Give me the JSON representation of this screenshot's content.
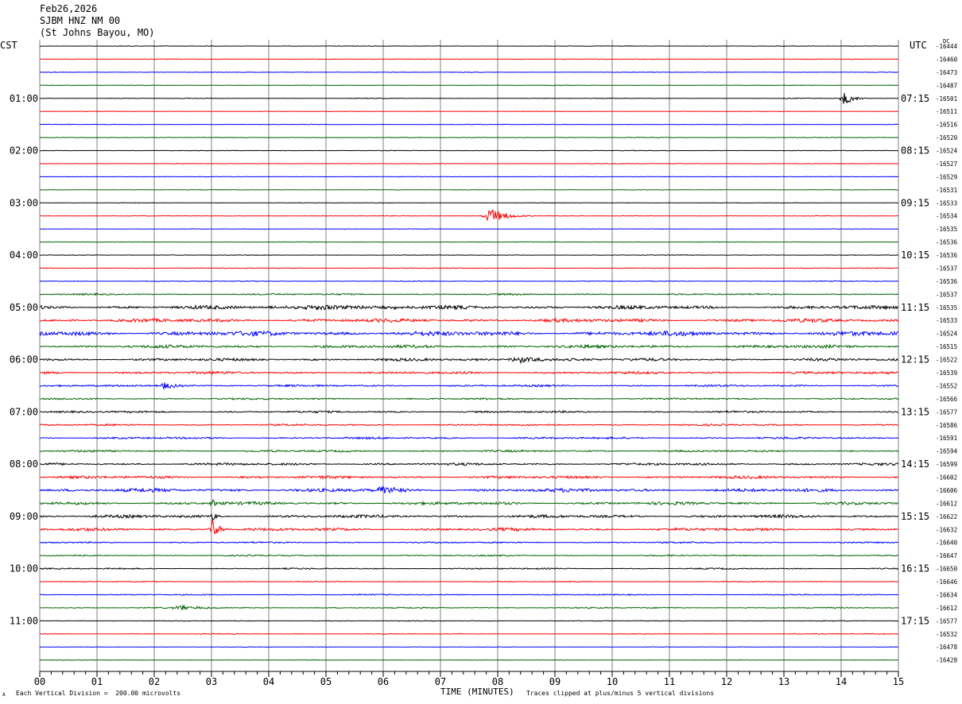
{
  "header": {
    "date": "Feb26,2026",
    "station": "SJBM HNZ NM 00",
    "location": "(St Johns Bayou, MO)"
  },
  "left_tz": "CST",
  "right_tz": "UTC",
  "dc_label": "DC",
  "footer": {
    "scale_note": "Each Vertical Division =  200.00 microvolts",
    "x_title": "TIME (MINUTES)",
    "clip_note": "Traces clipped at plus/minus 5 vertical divisions",
    "corner_mark": "A"
  },
  "colors": {
    "trace_cycle": [
      "#000000",
      "#ff0000",
      "#0000ff",
      "#006400"
    ],
    "grid": "#808080"
  },
  "chart_data": {
    "type": "line",
    "subtype": "helicorder",
    "x_label": "TIME (MINUTES)",
    "x_ticks": [
      "00",
      "01",
      "02",
      "03",
      "04",
      "05",
      "06",
      "07",
      "08",
      "09",
      "10",
      "11",
      "12",
      "13",
      "14",
      "15"
    ],
    "xlim": [
      0,
      15
    ],
    "minor_ticks_per_minute": 5,
    "grid": true,
    "rows": [
      {
        "left": "",
        "right": "",
        "dc": "-16444"
      },
      {
        "left": "",
        "right": "",
        "dc": "-16460"
      },
      {
        "left": "",
        "right": "",
        "dc": "-16473"
      },
      {
        "left": "",
        "right": "",
        "dc": "-16487"
      },
      {
        "left": "01:00",
        "right": "07:15",
        "dc": "-16501"
      },
      {
        "left": "",
        "right": "",
        "dc": "-16511"
      },
      {
        "left": "",
        "right": "",
        "dc": "-16516"
      },
      {
        "left": "",
        "right": "",
        "dc": "-16520"
      },
      {
        "left": "02:00",
        "right": "08:15",
        "dc": "-16524"
      },
      {
        "left": "",
        "right": "",
        "dc": "-16527"
      },
      {
        "left": "",
        "right": "",
        "dc": "-16529"
      },
      {
        "left": "",
        "right": "",
        "dc": "-16531"
      },
      {
        "left": "03:00",
        "right": "09:15",
        "dc": "-16533"
      },
      {
        "left": "",
        "right": "",
        "dc": "-16534"
      },
      {
        "left": "",
        "right": "",
        "dc": "-16535"
      },
      {
        "left": "",
        "right": "",
        "dc": "-16536"
      },
      {
        "left": "04:00",
        "right": "10:15",
        "dc": "-16536"
      },
      {
        "left": "",
        "right": "",
        "dc": "-16537"
      },
      {
        "left": "",
        "right": "",
        "dc": "-16536"
      },
      {
        "left": "",
        "right": "",
        "dc": "-16537"
      },
      {
        "left": "05:00",
        "right": "11:15",
        "dc": "-16535"
      },
      {
        "left": "",
        "right": "",
        "dc": "-16533"
      },
      {
        "left": "",
        "right": "",
        "dc": "-16524"
      },
      {
        "left": "",
        "right": "",
        "dc": "-16515"
      },
      {
        "left": "06:00",
        "right": "12:15",
        "dc": "-16522"
      },
      {
        "left": "",
        "right": "",
        "dc": "-16539"
      },
      {
        "left": "",
        "right": "",
        "dc": "-16552"
      },
      {
        "left": "",
        "right": "",
        "dc": "-16566"
      },
      {
        "left": "07:00",
        "right": "13:15",
        "dc": "-16577"
      },
      {
        "left": "",
        "right": "",
        "dc": "-16586"
      },
      {
        "left": "",
        "right": "",
        "dc": "-16591"
      },
      {
        "left": "",
        "right": "",
        "dc": "-16594"
      },
      {
        "left": "08:00",
        "right": "14:15",
        "dc": "-16599"
      },
      {
        "left": "",
        "right": "",
        "dc": "-16602"
      },
      {
        "left": "",
        "right": "",
        "dc": "-16606"
      },
      {
        "left": "",
        "right": "",
        "dc": "-16612"
      },
      {
        "left": "09:00",
        "right": "15:15",
        "dc": "-16622"
      },
      {
        "left": "",
        "right": "",
        "dc": "-16632"
      },
      {
        "left": "",
        "right": "",
        "dc": "-16640"
      },
      {
        "left": "",
        "right": "",
        "dc": "-16647"
      },
      {
        "left": "10:00",
        "right": "16:15",
        "dc": "-16650"
      },
      {
        "left": "",
        "right": "",
        "dc": "-16646"
      },
      {
        "left": "",
        "right": "",
        "dc": "-16634"
      },
      {
        "left": "",
        "right": "",
        "dc": "-16612"
      },
      {
        "left": "11:00",
        "right": "17:15",
        "dc": "-16577"
      },
      {
        "left": "",
        "right": "",
        "dc": "-16532"
      },
      {
        "left": "",
        "right": "",
        "dc": "-16478"
      },
      {
        "left": "",
        "right": "",
        "dc": "-16428"
      }
    ],
    "noise_level": [
      0.3,
      0.3,
      0.3,
      0.3,
      0.35,
      0.3,
      0.3,
      0.3,
      0.3,
      0.3,
      0.3,
      0.3,
      0.3,
      0.3,
      0.3,
      0.3,
      0.35,
      0.35,
      0.4,
      0.8,
      1.8,
      1.8,
      2.4,
      1.6,
      1.4,
      1.3,
      1.0,
      0.9,
      1.0,
      0.9,
      1.0,
      1.0,
      1.2,
      1.4,
      1.8,
      1.5,
      1.5,
      1.5,
      0.8,
      0.7,
      0.7,
      0.5,
      0.6,
      0.6,
      0.4,
      0.4,
      0.3,
      0.3
    ],
    "events": [
      {
        "row": 4,
        "minute": 14.05,
        "amplitude": 10,
        "duration": 0.15
      },
      {
        "row": 13,
        "minute": 7.9,
        "amplitude": 9,
        "duration": 0.3
      },
      {
        "row": 37,
        "minute": 3.02,
        "amplitude": 14,
        "duration": 0.12
      },
      {
        "row": 36,
        "minute": 3.02,
        "amplitude": 6,
        "duration": 0.1
      },
      {
        "row": 35,
        "minute": 3.02,
        "amplitude": 5,
        "duration": 0.1
      },
      {
        "row": 34,
        "minute": 6.0,
        "amplitude": 5,
        "duration": 0.3
      },
      {
        "row": 24,
        "minute": 8.4,
        "amplitude": 4,
        "duration": 0.5
      },
      {
        "row": 26,
        "minute": 2.2,
        "amplitude": 4,
        "duration": 0.3
      },
      {
        "row": 43,
        "minute": 2.5,
        "amplitude": 3,
        "duration": 0.4
      },
      {
        "row": 20,
        "minute": 5.0,
        "amplitude": 3,
        "duration": 1.2
      }
    ]
  }
}
